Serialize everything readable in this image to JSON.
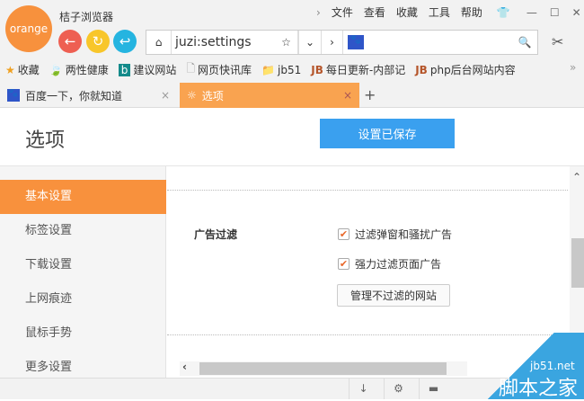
{
  "app": {
    "logo_text": "orange",
    "title": "桔子浏览器"
  },
  "menu": [
    "文件",
    "查看",
    "收藏",
    "工具",
    "帮助"
  ],
  "address": {
    "url": "juzi:settings",
    "search_value": ""
  },
  "bookmarks": [
    "收藏",
    "两性健康",
    "建议网站",
    "网页快讯库",
    "jb51",
    "每日更新-内部记",
    "php后台网站内容"
  ],
  "tabs": [
    {
      "label": "百度一下，你就知道",
      "active": false
    },
    {
      "label": "选项",
      "active": true
    }
  ],
  "page": {
    "title": "选项",
    "saved_button": "设置已保存"
  },
  "sidebar": [
    "基本设置",
    "标签设置",
    "下载设置",
    "上网痕迹",
    "鼠标手势",
    "更多设置"
  ],
  "adfilter": {
    "label": "广告过滤",
    "options": [
      {
        "label": "过滤弹窗和骚扰广告",
        "checked": true
      },
      {
        "label": "强力过滤页面广告",
        "checked": true
      }
    ],
    "manage_button": "管理不过滤的网站"
  },
  "watermark": {
    "site": "jb51.net",
    "name": "脚本之家"
  },
  "colors": {
    "accent": "#f8913d",
    "blue": "#3aa0ef"
  }
}
